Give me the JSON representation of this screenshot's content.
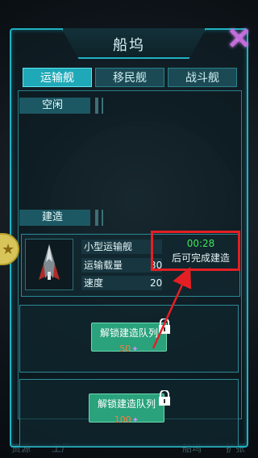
{
  "header": {
    "title": "船坞"
  },
  "tabs": [
    {
      "label": "运输舰",
      "active": true
    },
    {
      "label": "移民舰",
      "active": false
    },
    {
      "label": "战斗舰",
      "active": false
    }
  ],
  "sections": {
    "idle_label": "空闲",
    "build_label": "建造"
  },
  "building": {
    "ship_name": "小型运输舰",
    "stat_cargo_label": "运输载量",
    "stat_cargo_value": "30",
    "stat_speed_label": "速度",
    "stat_speed_value": "20",
    "timer": "00:28",
    "timer_suffix": "后可完成建造"
  },
  "slots": [
    {
      "label": "解锁建造队列",
      "cost": "50"
    },
    {
      "label": "解锁建造队列",
      "cost": "100"
    }
  ],
  "bottom_nav": [
    "资源",
    "工厂",
    "船坞",
    "扩张"
  ],
  "colors": {
    "accent": "#1fb2c4",
    "highlight": "#e41f24",
    "timer": "#3fe65a",
    "unlock": "#2aa27c"
  }
}
